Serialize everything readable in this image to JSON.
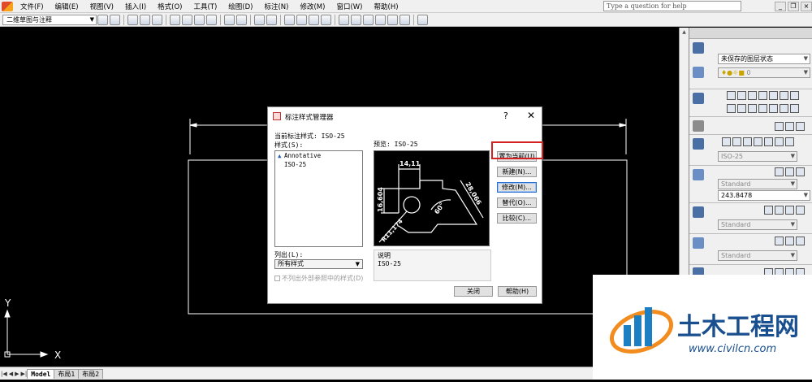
{
  "menubar": {
    "items": [
      "文件(F)",
      "编辑(E)",
      "视图(V)",
      "插入(I)",
      "格式(O)",
      "工具(T)",
      "绘图(D)",
      "标注(N)",
      "修改(M)",
      "窗口(W)",
      "帮助(H)"
    ],
    "help_placeholder": "Type a question for help"
  },
  "toolbar": {
    "workspace": "二维草图与注释"
  },
  "axes": {
    "y": "Y",
    "x": "X"
  },
  "layout_tabs": {
    "model": "Model",
    "layout1": "布局1",
    "layout2": "布局2"
  },
  "palette": {
    "layer_state": "未保存的图层状态",
    "layer_current": "0",
    "dim_style": "ISO-25",
    "text_style": "Standard",
    "text_height": "243.8478",
    "multileader_style": "Standard",
    "table_style": "Standard"
  },
  "dialog": {
    "title": "标注样式管理器",
    "help": "?",
    "close": "✕",
    "current_style_label": "当前标注样式: ISO-25",
    "styles_label": "样式(S):",
    "styles": [
      "Annotative",
      "ISO-25"
    ],
    "preview_label": "预览: ISO-25",
    "list_label": "列出(L):",
    "list_value": "所有样式",
    "exclude_xref_label": "不列出外部参照中的样式(D)",
    "desc_label": "说明",
    "desc_value": "ISO-25",
    "buttons": {
      "set_current": "置为当前(U)",
      "new": "新建(N)...",
      "modify": "修改(M)...",
      "override": "替代(O)...",
      "compare": "比较(C)...",
      "close": "关闭",
      "help": "帮助(H)"
    },
    "preview_dims": {
      "d1": "14,11",
      "d2": "16,604",
      "d3": "28,066",
      "angle": "60°",
      "radius": "R11,174"
    }
  },
  "watermark": {
    "brand": "土木工程网",
    "url": "www.civilcn.com"
  },
  "colors": {
    "highlight": "#d32020",
    "canvas": "#000000"
  }
}
